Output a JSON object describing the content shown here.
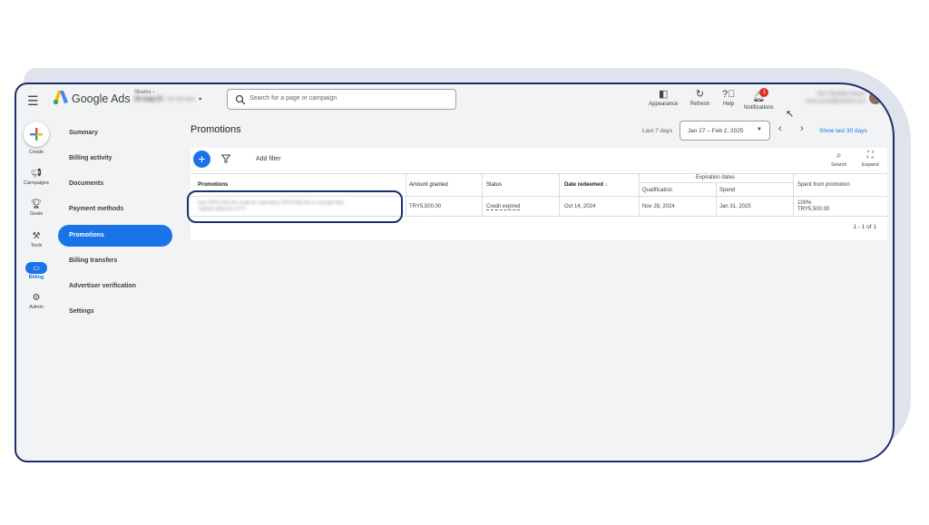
{
  "app": {
    "brand": "Google Ads",
    "account_top": "Shams",
    "account_name": "24 aug 21",
    "account_id": "401-401-4401",
    "search_placeholder": "Search for a page or campaign"
  },
  "toolbar": {
    "appearance": "Appearance",
    "refresh": "Refresh",
    "help": "Help",
    "notifications": "Notifications",
    "notif_count": "1",
    "user_line1": "851-798-6840 Shams",
    "user_line2": "shms.yousef@outlook.com"
  },
  "rail": {
    "create": "Create",
    "campaigns": "Campaigns",
    "goals": "Goals",
    "tools": "Tools",
    "billing": "Billing",
    "admin": "Admin"
  },
  "nav": {
    "summary": "Summary",
    "billing_activity": "Billing activity",
    "documents": "Documents",
    "payment_methods": "Payment methods",
    "promotions": "Promotions",
    "billing_transfers": "Billing transfers",
    "advertiser_verification": "Advertiser verification",
    "settings": "Settings"
  },
  "page": {
    "title": "Promotions",
    "date_label": "Last 7 days",
    "date_range": "Jan 27 – Feb 2, 2025",
    "show_last": "Show last 30 days",
    "add_filter": "Add filter",
    "search_tool": "Search",
    "expand_tool": "Expand"
  },
  "table": {
    "headers": {
      "promotions": "Promotions",
      "amount_granted": "Amount granted",
      "status": "Status",
      "date_redeemed": "Date redeemed",
      "expiration_dates": "Expiration dates",
      "qualification": "Qualification",
      "spend": "Spend",
      "spent_from_promotion": "Spent from promotion"
    },
    "row": {
      "promotion_line1": "Get TRY5,500.00 credit for spending TRY5,500.00 on Google Ads",
      "promotion_line2": "7QE2E-RW2JX-3YTT",
      "amount": "TRY5,500.00",
      "status": "Credit expired",
      "date_redeemed": "Oct 14, 2024",
      "qualification": "Nov 28, 2024",
      "spend": "Jan 31, 2025",
      "spent_pct": "100%",
      "spent_amount": "TRY5,500.00"
    },
    "pager": "1 - 1 of 1"
  }
}
